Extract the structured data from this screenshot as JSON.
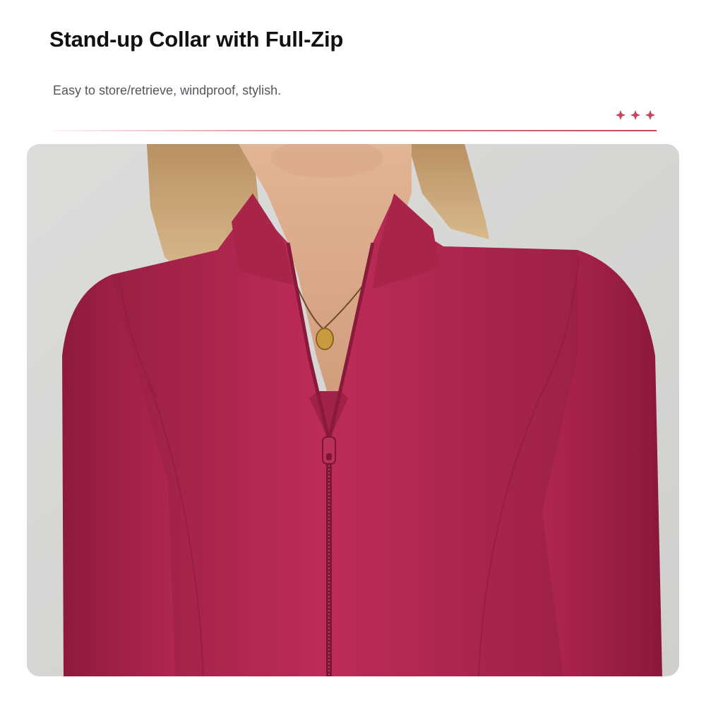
{
  "header": {
    "title": "Stand-up Collar with Full-Zip",
    "subtitle": "Easy to store/retrieve, windproof, stylish."
  },
  "decor": {
    "star_icon": "four-point-sparkle",
    "star_color": "#c4475a",
    "divider_color": "#c4475a"
  },
  "product_image": {
    "garment_color": "#b02650",
    "background_color": "#d9d9d8",
    "subject": "woman wearing a full-zip stand-up collar jacket with pendant necklace"
  }
}
